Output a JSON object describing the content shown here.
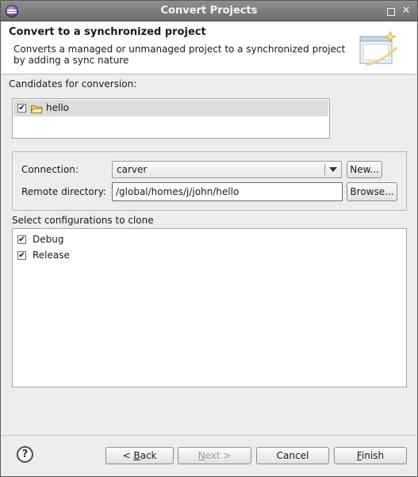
{
  "window": {
    "title": "Convert Projects"
  },
  "banner": {
    "title": "Convert to a synchronized project",
    "message": "Converts a managed or unmanaged project to a synchronized project by adding a sync nature"
  },
  "candidates": {
    "label": "Candidates for conversion:",
    "items": [
      {
        "name": "hello",
        "checked": true,
        "icon": "folder-icon"
      }
    ]
  },
  "connection": {
    "label": "Connection:",
    "value": "carver",
    "new_button": "New..."
  },
  "remote_directory": {
    "label": "Remote directory:",
    "value": "/global/homes/j/john/hello",
    "browse_button": "Browse..."
  },
  "configurations": {
    "label": "Select configurations to clone",
    "items": [
      {
        "name": "Debug",
        "checked": true
      },
      {
        "name": "Release",
        "checked": true
      }
    ]
  },
  "footer": {
    "help_icon": "?",
    "back": {
      "prefix": "< ",
      "mnemonic": "B",
      "rest": "ack"
    },
    "next": {
      "mnemonic": "N",
      "rest": "ext >",
      "enabled": false
    },
    "cancel": "Cancel",
    "finish": {
      "mnemonic": "F",
      "rest": "inish"
    }
  },
  "checkmark": "✔"
}
